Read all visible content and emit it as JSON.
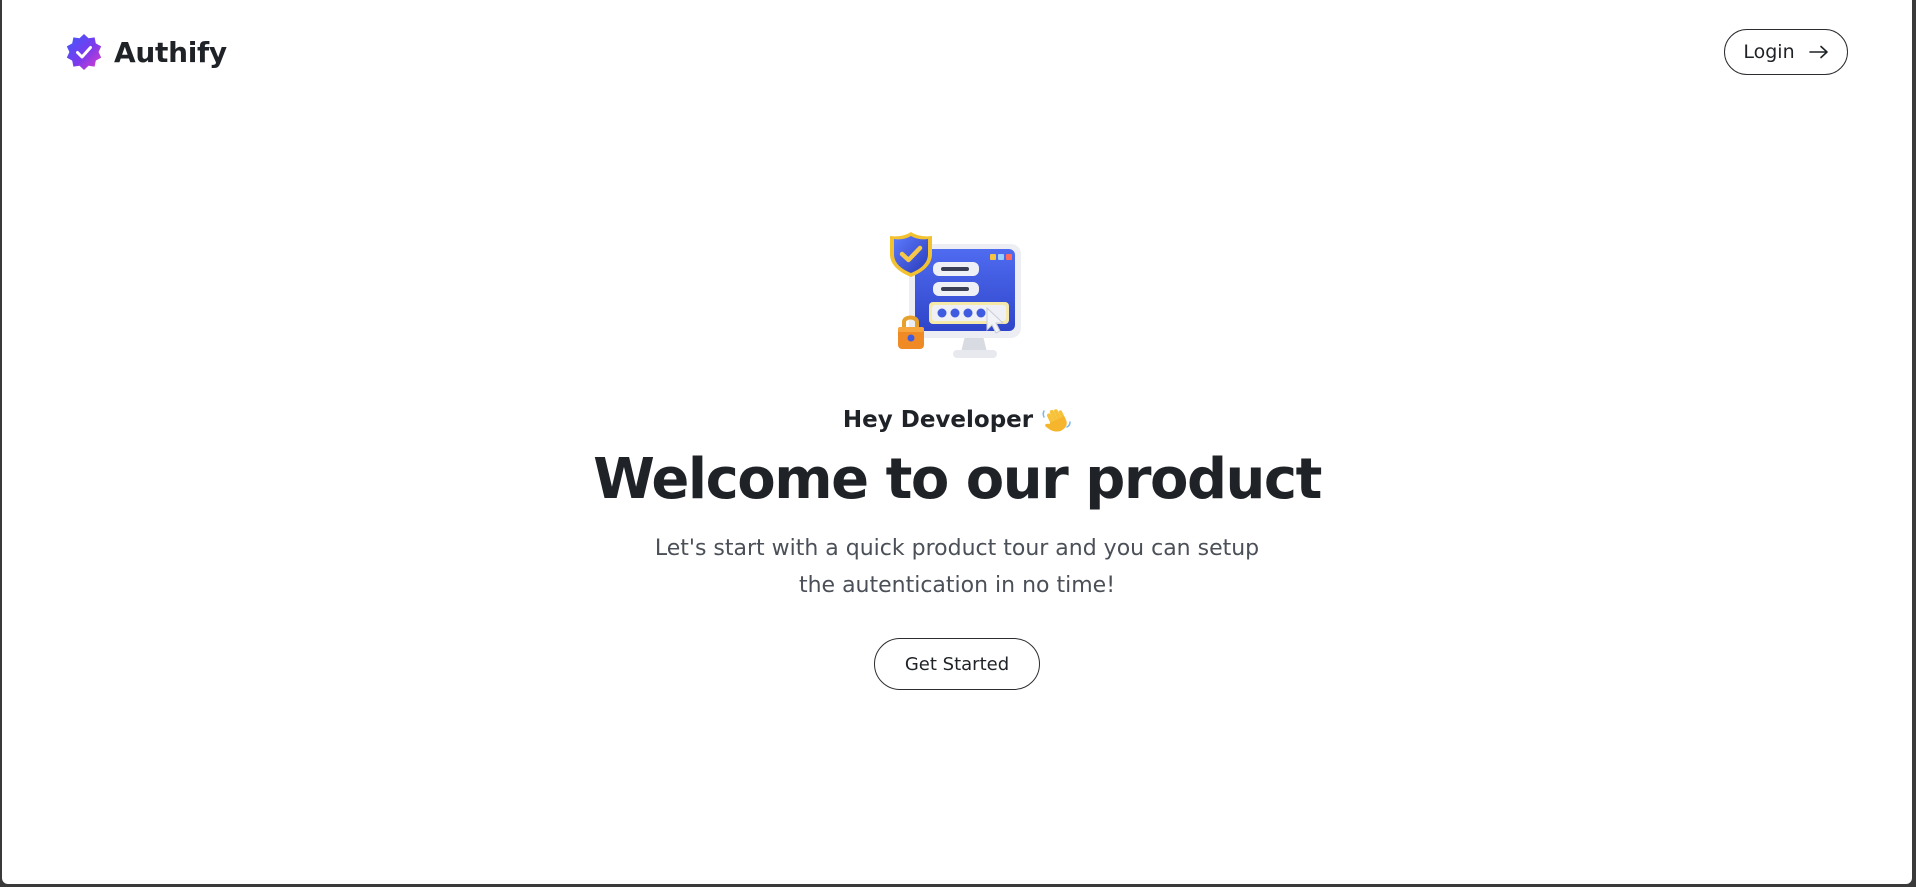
{
  "brand": {
    "name": "Authify",
    "icon": "verified-badge-icon",
    "colors": {
      "badge_start": "#4f46e5",
      "badge_end": "#d946ef"
    }
  },
  "header": {
    "login_label": "Login",
    "login_icon": "arrow-right-icon"
  },
  "hero": {
    "illustration": "secure-login-computer-icon",
    "greeting": "Hey Developer",
    "greeting_icon": "waving-hand-icon",
    "headline": "Welcome to our product",
    "subtitle_line1": "Let's start with a quick product tour and you can setup",
    "subtitle_line2": "the autentication in no time!",
    "cta_label": "Get Started"
  },
  "colors": {
    "text": "#1f2226",
    "muted_text": "#4b5058",
    "background": "#ffffff",
    "border": "#2b2d31"
  }
}
